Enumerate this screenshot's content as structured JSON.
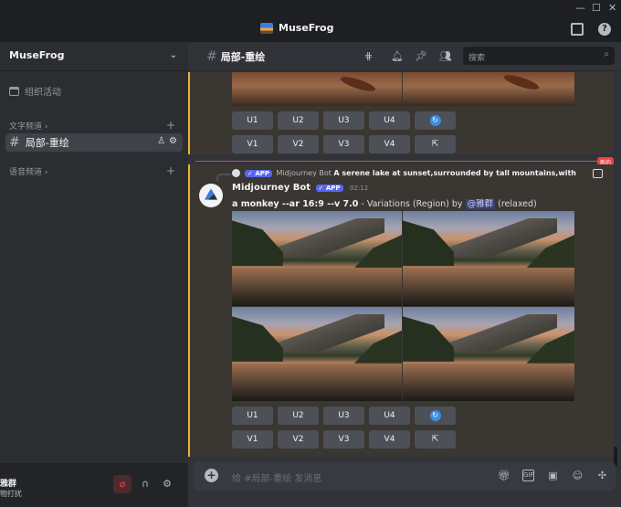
{
  "window": {
    "app_title": "MuseFrog",
    "controls": [
      "—",
      "☐",
      "✕"
    ]
  },
  "sidebar": {
    "server_name": "MuseFrog",
    "events_label": "组织活动",
    "text_category": "文字频道",
    "voice_category": "语音频道",
    "active_channel": "局部-重绘",
    "user": {
      "name": "雅群",
      "status": "物打扰"
    }
  },
  "channel_header": {
    "title": "局部-重绘",
    "search_placeholder": "搜索"
  },
  "buttons_row1": [
    "U1",
    "U2",
    "U3",
    "U4"
  ],
  "buttons_row2": [
    "V1",
    "V2",
    "V3",
    "V4"
  ],
  "new_badge": "新的",
  "message": {
    "reply_author": "Midjourney Bot",
    "reply_app": "APP",
    "reply_text": "A serene lake at sunset,surrounded by tall mountains,with sof...",
    "author": "Midjourney Bot",
    "app_badge": "APP",
    "timestamp": "02:12",
    "prompt_bold": "a monkey --ar 16:9 --v 7.0",
    "prompt_rest": " - Variations (Region) by ",
    "mention": "@雅群",
    "mode": " (relaxed)"
  },
  "composer": {
    "placeholder": "给 #局部-重绘 发消息"
  },
  "icons": [
    "inbox-icon",
    "help-icon",
    "threads-icon",
    "bell-icon",
    "pin-icon",
    "members-icon",
    "search-icon",
    "refresh-icon",
    "open-link-icon",
    "image-icon",
    "gift-icon",
    "gif-icon",
    "sticker-icon",
    "emoji-icon",
    "apps-icon",
    "mic-muted-icon",
    "headphones-icon",
    "settings-icon"
  ]
}
